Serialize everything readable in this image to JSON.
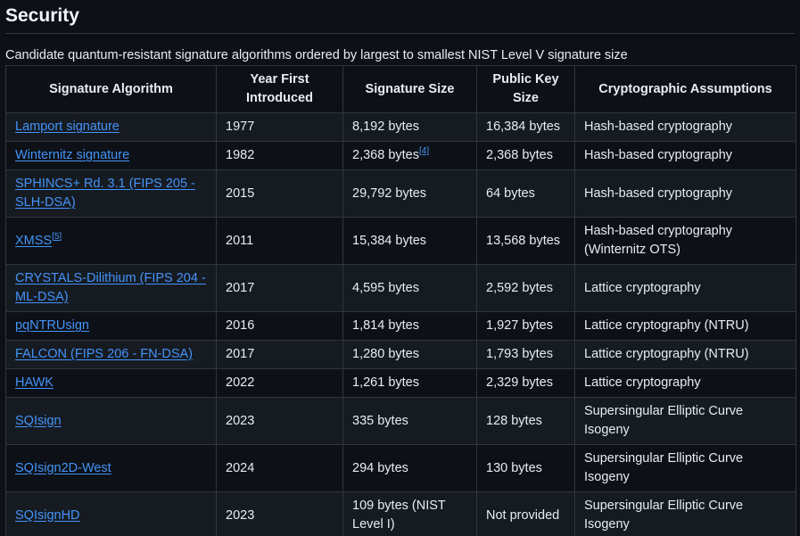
{
  "section": {
    "title": "Security",
    "caption": "Candidate quantum-resistant signature algorithms ordered by largest to smallest NIST Level V signature size"
  },
  "table": {
    "headers": [
      "Signature Algorithm",
      "Year First Introduced",
      "Signature Size",
      "Public Key Size",
      "Cryptographic Assumptions"
    ],
    "rows": [
      {
        "name": "Lamport signature",
        "year": "1977",
        "sig": "8,192 bytes",
        "sig_ref": "",
        "pub": "16,384 bytes",
        "assump": "Hash-based cryptography",
        "name_ref": ""
      },
      {
        "name": "Winternitz signature",
        "year": "1982",
        "sig": "2,368 bytes",
        "sig_ref": "[4]",
        "pub": "2,368 bytes",
        "assump": "Hash-based cryptography",
        "name_ref": ""
      },
      {
        "name": "SPHINCS+ Rd. 3.1 (FIPS 205 - SLH-DSA)",
        "year": "2015",
        "sig": "29,792 bytes",
        "sig_ref": "",
        "pub": "64 bytes",
        "assump": "Hash-based cryptography",
        "name_ref": ""
      },
      {
        "name": "XMSS",
        "year": "2011",
        "sig": "15,384 bytes",
        "sig_ref": "",
        "pub": "13,568 bytes",
        "assump": "Hash-based cryptography (Winternitz OTS)",
        "name_ref": "[5]"
      },
      {
        "name": "CRYSTALS-Dilithium (FIPS 204 - ML-DSA)",
        "year": "2017",
        "sig": "4,595 bytes",
        "sig_ref": "",
        "pub": "2,592 bytes",
        "assump": "Lattice cryptography",
        "name_ref": ""
      },
      {
        "name": "pqNTRUsign",
        "year": "2016",
        "sig": "1,814 bytes",
        "sig_ref": "",
        "pub": "1,927 bytes",
        "assump": "Lattice cryptography (NTRU)",
        "name_ref": ""
      },
      {
        "name": "FALCON (FIPS 206 - FN-DSA)",
        "year": "2017",
        "sig": "1,280 bytes",
        "sig_ref": "",
        "pub": "1,793 bytes",
        "assump": "Lattice cryptography (NTRU)",
        "name_ref": ""
      },
      {
        "name": "HAWK",
        "year": "2022",
        "sig": "1,261 bytes",
        "sig_ref": "",
        "pub": "2,329 bytes",
        "assump": "Lattice cryptography",
        "name_ref": ""
      },
      {
        "name": "SQIsign",
        "year": "2023",
        "sig": "335 bytes",
        "sig_ref": "",
        "pub": "128 bytes",
        "assump": "Supersingular Elliptic Curve Isogeny",
        "name_ref": ""
      },
      {
        "name": "SQIsign2D-West",
        "year": "2024",
        "sig": "294 bytes",
        "sig_ref": "",
        "pub": "130 bytes",
        "assump": "Supersingular Elliptic Curve Isogeny",
        "name_ref": ""
      },
      {
        "name": "SQIsignHD",
        "year": "2023",
        "sig": "109 bytes (NIST Level I)",
        "sig_ref": "",
        "pub": "Not provided",
        "assump": "Supersingular Elliptic Curve Isogeny",
        "name_ref": ""
      }
    ]
  }
}
